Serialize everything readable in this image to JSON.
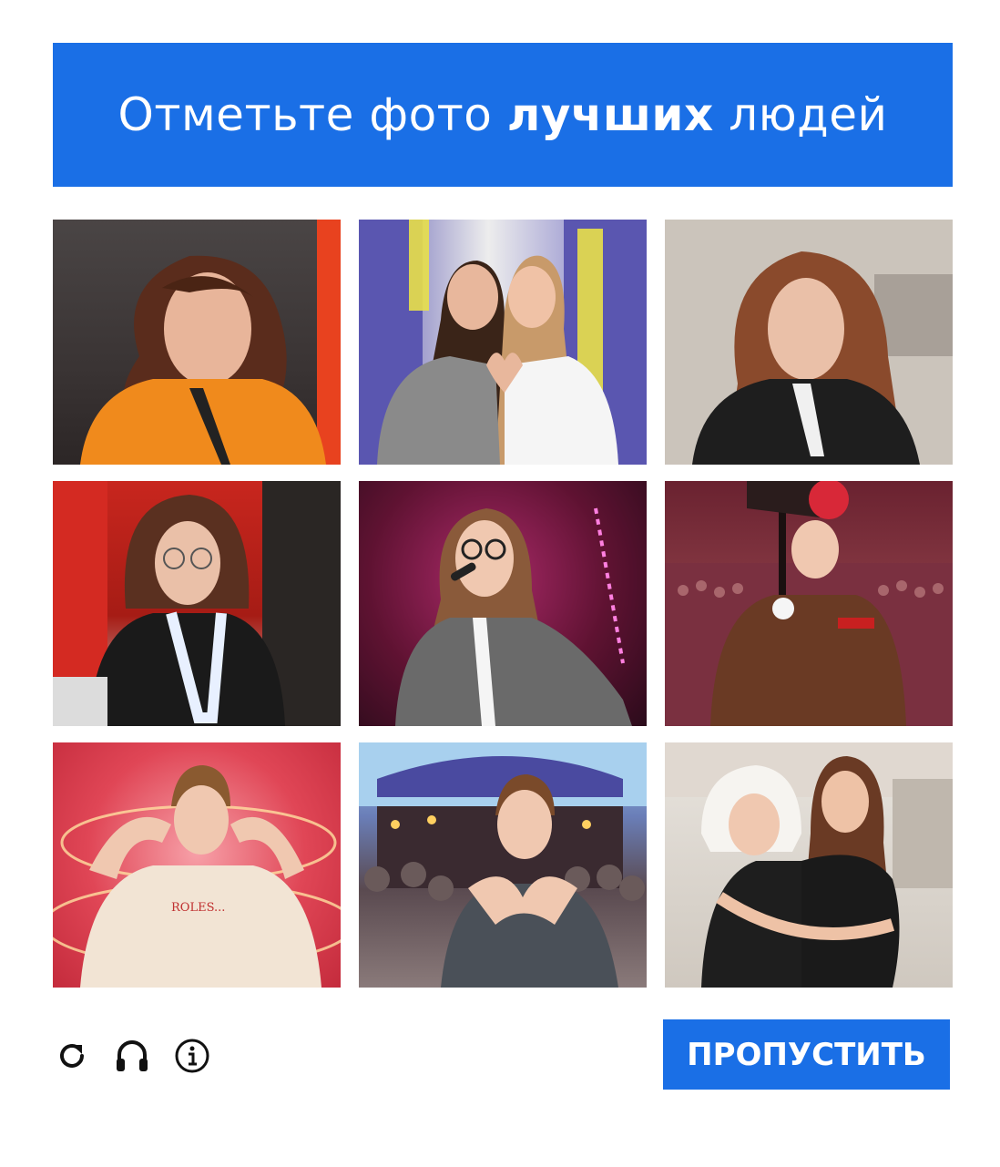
{
  "header": {
    "title_prefix": "Отметьте фото ",
    "title_bold": "лучших",
    "title_suffix": " людей",
    "background": "#1a6fe6"
  },
  "grid": {
    "tiles": [
      {
        "id": 1,
        "description": "photo"
      },
      {
        "id": 2,
        "description": "photo"
      },
      {
        "id": 3,
        "description": "photo"
      },
      {
        "id": 4,
        "description": "photo"
      },
      {
        "id": 5,
        "description": "photo"
      },
      {
        "id": 6,
        "description": "photo"
      },
      {
        "id": 7,
        "description": "photo"
      },
      {
        "id": 8,
        "description": "photo"
      },
      {
        "id": 9,
        "description": "photo"
      }
    ]
  },
  "footer": {
    "icons": [
      "refresh-icon",
      "headphones-icon",
      "info-icon"
    ],
    "skip_label": "ПРОПУСТИТЬ",
    "skip_color": "#1a6fe6"
  }
}
